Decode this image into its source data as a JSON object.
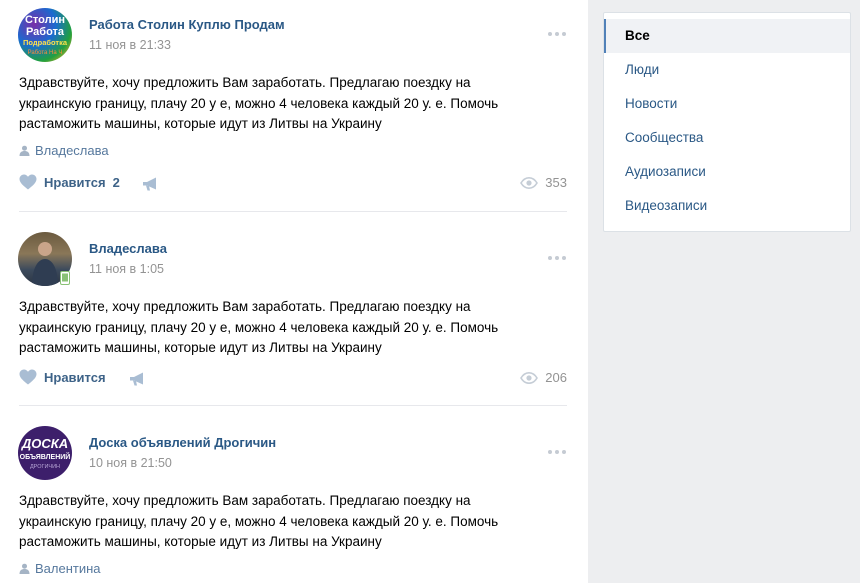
{
  "posts": [
    {
      "author": "Работа Столин Куплю Продам",
      "date": "11 ноя в 21:33",
      "text": "Здравствуйте, хочу предложить Вам заработать. Предлагаю поездку на украинскую границу, плачу 20 у е, можно 4 человека каждый 20 у. е. Помочь растаможить машины, которые идут из Литвы на Украину",
      "signer": "Владеслава",
      "like_label": "Нравится",
      "like_count": "2",
      "views": "353",
      "avatar_text": [
        "Столин",
        "Работа",
        "Подработка",
        "Работа На Ч"
      ]
    },
    {
      "author": "Владеслава",
      "date": "11 ноя в 1:05",
      "text": "Здравствуйте, хочу предложить Вам заработать. Предлагаю поездку на украинскую границу, плачу 20 у е, можно 4 человека каждый 20 у. е. Помочь растаможить машины, которые идут из Литвы на Украину",
      "like_label": "Нравится",
      "like_count": "",
      "views": "206"
    },
    {
      "author": "Доска объявлений Дрогичин",
      "date": "10 ноя в 21:50",
      "text": "Здравствуйте, хочу предложить Вам заработать. Предлагаю поездку на украинскую границу, плачу 20 у е, можно 4 человека каждый 20 у. е. Помочь растаможить машины, которые идут из Литвы на Украину",
      "signer": "Валентина",
      "avatar_text": [
        "ДОСКА",
        "ОБЪЯВЛЕНИЙ",
        "ДРОГИЧИН"
      ]
    }
  ],
  "sidebar": {
    "items": [
      {
        "label": "Все",
        "active": true
      },
      {
        "label": "Люди"
      },
      {
        "label": "Новости"
      },
      {
        "label": "Сообщества"
      },
      {
        "label": "Аудиозаписи"
      },
      {
        "label": "Видеозаписи"
      }
    ]
  },
  "colors": {
    "link": "#2a5885",
    "muted": "#939393",
    "background": "#edeef0"
  }
}
